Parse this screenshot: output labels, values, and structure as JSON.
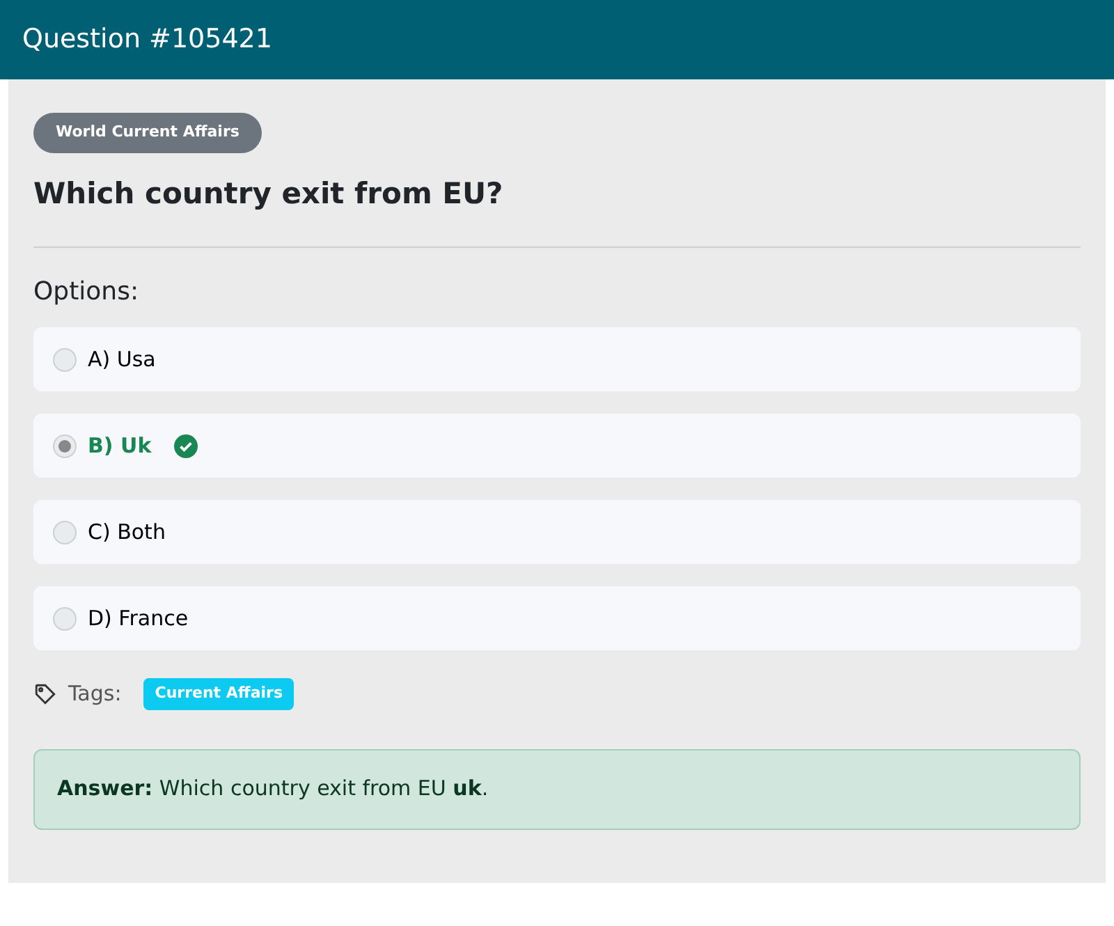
{
  "header": {
    "title": "Question #105421"
  },
  "category": "World Current Affairs",
  "question": "Which country exit from EU?",
  "options_label": "Options:",
  "options": [
    {
      "label": "A) Usa",
      "selected": false,
      "correct": false
    },
    {
      "label": "B) Uk",
      "selected": true,
      "correct": true
    },
    {
      "label": "C) Both",
      "selected": false,
      "correct": false
    },
    {
      "label": "D) France",
      "selected": false,
      "correct": false
    }
  ],
  "tags_label": "Tags:",
  "tags": [
    "Current Affairs"
  ],
  "answer": "**Answer:** Which country exit from EU **uk**."
}
